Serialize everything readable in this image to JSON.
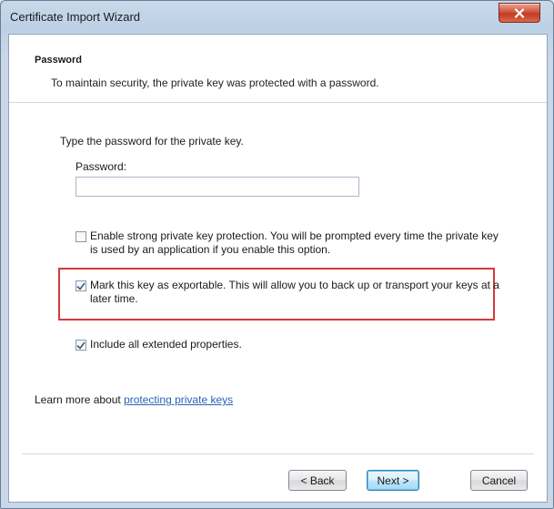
{
  "window": {
    "title": "Certificate Import Wizard"
  },
  "header": {
    "title": "Password",
    "description": "To maintain security, the private key was protected with a password."
  },
  "form": {
    "prompt": "Type the password for the private key.",
    "password_label": "Password:",
    "password_value": "",
    "password_placeholder": ""
  },
  "options": [
    {
      "label": "Enable strong private key protection. You will be prompted every time the private key is used by an application if you enable this option.",
      "checked": false
    },
    {
      "label": "Mark this key as exportable. This will allow you to back up or transport your keys at a later time.",
      "checked": true
    },
    {
      "label": "Include all extended properties.",
      "checked": true
    }
  ],
  "learn_more": {
    "prefix": "Learn more about ",
    "link": "protecting private keys"
  },
  "buttons": {
    "back": "< Back",
    "next": "Next >",
    "cancel": "Cancel"
  },
  "colors": {
    "highlight_border": "#d23a3a",
    "link": "#2a62b5",
    "close_button": "#c9452c"
  }
}
